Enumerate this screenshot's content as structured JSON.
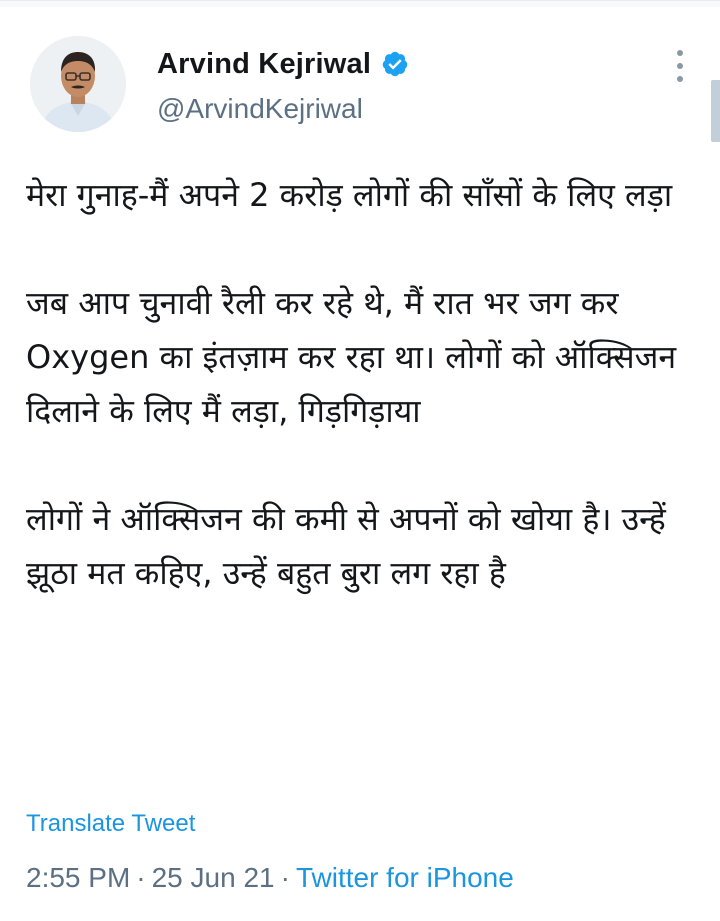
{
  "author": {
    "display_name": "Arvind Kejriwal",
    "handle": "@ArvindKejriwal",
    "verified": true,
    "avatar_icon": "profile-photo",
    "verified_icon": "verified-badge-icon",
    "verified_color": "#1da1f2"
  },
  "tweet": {
    "paragraphs": [
      "मेरा गुनाह-मैं अपने 2 करोड़ लोगों की साँसों के लिए लड़ा",
      "जब आप चुनावी रैली कर रहे थे, मैं रात भर जग कर Oxygen का इंतज़ाम कर रहा था। लोगों को ऑक्सिजन दिलाने के लिए मैं लड़ा, गिड़गिड़ाया",
      "लोगों ने ऑक्सिजन की कमी से अपनों को खोया है। उन्हें झूठा मत कहिए, उन्हें बहुत बुरा लग रहा है"
    ],
    "translate_label": "Translate Tweet"
  },
  "meta": {
    "time": "2:55 PM",
    "separator": "·",
    "date": "25 Jun 21",
    "source": "Twitter for iPhone"
  },
  "colors": {
    "link": "#1b95e0",
    "secondary_text": "#5b7083",
    "primary_text": "#14171a"
  }
}
